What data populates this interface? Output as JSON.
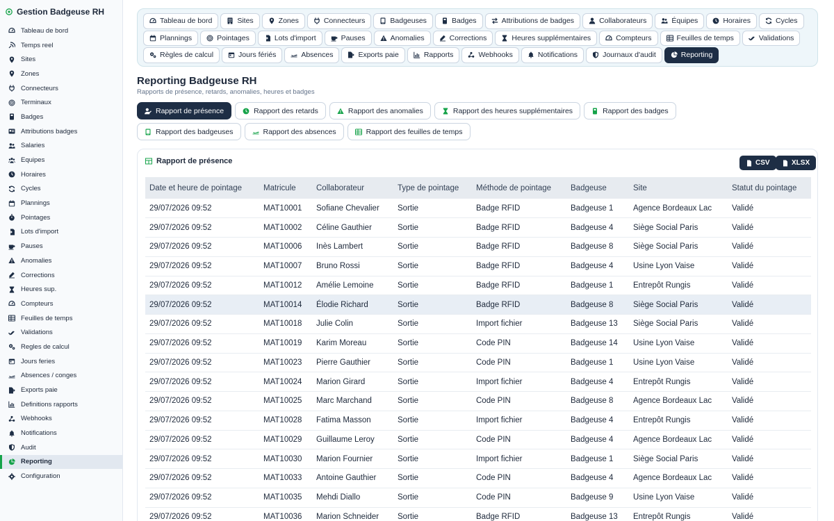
{
  "app": {
    "title": "Gestion Badgeuse RH"
  },
  "sidebar": {
    "items": [
      {
        "label": "Tableau de bord",
        "icon": "gauge-icon"
      },
      {
        "label": "Temps reel",
        "icon": "signal-icon"
      },
      {
        "label": "Sites",
        "icon": "location-pin-icon"
      },
      {
        "label": "Zones",
        "icon": "location-pin-icon"
      },
      {
        "label": "Connecteurs",
        "icon": "plug-icon"
      },
      {
        "label": "Terminaux",
        "icon": "fingerprint-icon"
      },
      {
        "label": "Badges",
        "icon": "badge-icon"
      },
      {
        "label": "Attributions badges",
        "icon": "id-card-icon"
      },
      {
        "label": "Salaries",
        "icon": "users-icon"
      },
      {
        "label": "Equipes",
        "icon": "team-icon"
      },
      {
        "label": "Horaires",
        "icon": "clock-icon"
      },
      {
        "label": "Cycles",
        "icon": "refresh-icon"
      },
      {
        "label": "Plannings",
        "icon": "calendar-icon"
      },
      {
        "label": "Pointages",
        "icon": "stopwatch-icon"
      },
      {
        "label": "Lots d'import",
        "icon": "file-import-icon"
      },
      {
        "label": "Pauses",
        "icon": "coffee-icon"
      },
      {
        "label": "Anomalies",
        "icon": "warning-icon"
      },
      {
        "label": "Corrections",
        "icon": "edit-icon"
      },
      {
        "label": "Heures sup.",
        "icon": "hourglass-icon"
      },
      {
        "label": "Compteurs",
        "icon": "gauge-icon"
      },
      {
        "label": "Feuilles de temps",
        "icon": "timesheet-icon"
      },
      {
        "label": "Validations",
        "icon": "check-double-icon"
      },
      {
        "label": "Regles de calcul",
        "icon": "cogs-icon"
      },
      {
        "label": "Jours feries",
        "icon": "calendar-day-icon"
      },
      {
        "label": "Absences / conges",
        "icon": "plane-icon"
      },
      {
        "label": "Exports paie",
        "icon": "file-export-icon"
      },
      {
        "label": "Definitions rapports",
        "icon": "chart-icon"
      },
      {
        "label": "Webhooks",
        "icon": "webhook-icon"
      },
      {
        "label": "Notifications",
        "icon": "bell-icon"
      },
      {
        "label": "Audit",
        "icon": "shield-icon"
      },
      {
        "label": "Reporting",
        "icon": "pie-chart-icon",
        "active": true
      },
      {
        "label": "Configuration",
        "icon": "gear-icon"
      }
    ]
  },
  "tabs": [
    {
      "label": "Tableau de bord",
      "icon": "gauge-icon"
    },
    {
      "label": "Sites",
      "icon": "building-icon"
    },
    {
      "label": "Zones",
      "icon": "location-pin-icon"
    },
    {
      "label": "Connecteurs",
      "icon": "plug-icon"
    },
    {
      "label": "Badgeuses",
      "icon": "tablet-icon"
    },
    {
      "label": "Badges",
      "icon": "badge-icon"
    },
    {
      "label": "Attributions de badges",
      "icon": "exchange-icon"
    },
    {
      "label": "Collaborateurs",
      "icon": "user-icon"
    },
    {
      "label": "Équipes",
      "icon": "users-icon"
    },
    {
      "label": "Horaires",
      "icon": "clock-icon"
    },
    {
      "label": "Cycles",
      "icon": "refresh-icon"
    },
    {
      "label": "Plannings",
      "icon": "calendar-icon"
    },
    {
      "label": "Pointages",
      "icon": "fingerprint-icon"
    },
    {
      "label": "Lots d'import",
      "icon": "file-import-icon"
    },
    {
      "label": "Pauses",
      "icon": "coffee-icon"
    },
    {
      "label": "Anomalies",
      "icon": "warning-icon"
    },
    {
      "label": "Corrections",
      "icon": "edit-icon"
    },
    {
      "label": "Heures supplémentaires",
      "icon": "hourglass-icon"
    },
    {
      "label": "Compteurs",
      "icon": "gauge-icon"
    },
    {
      "label": "Feuilles de temps",
      "icon": "timesheet-icon"
    },
    {
      "label": "Validations",
      "icon": "check-double-icon"
    },
    {
      "label": "Règles de calcul",
      "icon": "cogs-icon"
    },
    {
      "label": "Jours fériés",
      "icon": "calendar-day-icon"
    },
    {
      "label": "Absences",
      "icon": "plane-icon"
    },
    {
      "label": "Exports paie",
      "icon": "file-export-icon"
    },
    {
      "label": "Rapports",
      "icon": "chart-icon"
    },
    {
      "label": "Webhooks",
      "icon": "webhook-icon"
    },
    {
      "label": "Notifications",
      "icon": "bell-icon"
    },
    {
      "label": "Journaux d'audit",
      "icon": "shield-icon"
    },
    {
      "label": "Reporting",
      "icon": "pie-chart-icon",
      "active": true
    }
  ],
  "page": {
    "title": "Reporting Badgeuse RH",
    "subtitle": "Rapports de présence, retards, anomalies, heures et badges"
  },
  "reports": [
    {
      "label": "Rapport de présence",
      "icon": "user-check-icon",
      "active": true
    },
    {
      "label": "Rapport des retards",
      "icon": "clock-icon"
    },
    {
      "label": "Rapport des anomalies",
      "icon": "warning-icon"
    },
    {
      "label": "Rapport des heures supplémentaires",
      "icon": "hourglass-icon"
    },
    {
      "label": "Rapport des badges",
      "icon": "badge-icon"
    },
    {
      "label": "Rapport des badgeuses",
      "icon": "tablet-icon"
    },
    {
      "label": "Rapport des absences",
      "icon": "plane-icon"
    },
    {
      "label": "Rapport des feuilles de temps",
      "icon": "timesheet-icon"
    }
  ],
  "card": {
    "title": "Rapport de présence",
    "csv_label": "CSV",
    "xlsx_label": "XLSX"
  },
  "table": {
    "columns": [
      "Date et heure de pointage",
      "Matricule",
      "Collaborateur",
      "Type de pointage",
      "Méthode de pointage",
      "Badgeuse",
      "Site",
      "Statut du pointage"
    ],
    "rows": [
      [
        "29/07/2026 09:52",
        "MAT10001",
        "Sofiane Chevalier",
        "Sortie",
        "Badge RFID",
        "Badgeuse 1",
        "Agence Bordeaux Lac",
        "Validé"
      ],
      [
        "29/07/2026 09:52",
        "MAT10002",
        "Céline Gauthier",
        "Sortie",
        "Badge RFID",
        "Badgeuse 4",
        "Siège Social Paris",
        "Validé"
      ],
      [
        "29/07/2026 09:52",
        "MAT10006",
        "Inès Lambert",
        "Sortie",
        "Badge RFID",
        "Badgeuse 8",
        "Siège Social Paris",
        "Validé"
      ],
      [
        "29/07/2026 09:52",
        "MAT10007",
        "Bruno Rossi",
        "Sortie",
        "Badge RFID",
        "Badgeuse 4",
        "Usine Lyon Vaise",
        "Validé"
      ],
      [
        "29/07/2026 09:52",
        "MAT10012",
        "Amélie Lemoine",
        "Sortie",
        "Badge RFID",
        "Badgeuse 1",
        "Entrepôt Rungis",
        "Validé"
      ],
      [
        "29/07/2026 09:52",
        "MAT10014",
        "Élodie Richard",
        "Sortie",
        "Badge RFID",
        "Badgeuse 8",
        "Siège Social Paris",
        "Validé"
      ],
      [
        "29/07/2026 09:52",
        "MAT10018",
        "Julie Colin",
        "Sortie",
        "Import fichier",
        "Badgeuse 13",
        "Siège Social Paris",
        "Validé"
      ],
      [
        "29/07/2026 09:52",
        "MAT10019",
        "Karim Moreau",
        "Sortie",
        "Code PIN",
        "Badgeuse 14",
        "Usine Lyon Vaise",
        "Validé"
      ],
      [
        "29/07/2026 09:52",
        "MAT10023",
        "Pierre Gauthier",
        "Sortie",
        "Code PIN",
        "Badgeuse 1",
        "Usine Lyon Vaise",
        "Validé"
      ],
      [
        "29/07/2026 09:52",
        "MAT10024",
        "Marion Girard",
        "Sortie",
        "Import fichier",
        "Badgeuse 4",
        "Entrepôt Rungis",
        "Validé"
      ],
      [
        "29/07/2026 09:52",
        "MAT10025",
        "Marc Marchand",
        "Sortie",
        "Code PIN",
        "Badgeuse 8",
        "Agence Bordeaux Lac",
        "Validé"
      ],
      [
        "29/07/2026 09:52",
        "MAT10028",
        "Fatima Masson",
        "Sortie",
        "Import fichier",
        "Badgeuse 4",
        "Entrepôt Rungis",
        "Validé"
      ],
      [
        "29/07/2026 09:52",
        "MAT10029",
        "Guillaume Leroy",
        "Sortie",
        "Code PIN",
        "Badgeuse 4",
        "Agence Bordeaux Lac",
        "Validé"
      ],
      [
        "29/07/2026 09:52",
        "MAT10030",
        "Marion Fournier",
        "Sortie",
        "Import fichier",
        "Badgeuse 1",
        "Siège Social Paris",
        "Validé"
      ],
      [
        "29/07/2026 09:52",
        "MAT10033",
        "Antoine Gauthier",
        "Sortie",
        "Code PIN",
        "Badgeuse 4",
        "Agence Bordeaux Lac",
        "Validé"
      ],
      [
        "29/07/2026 09:52",
        "MAT10035",
        "Mehdi Diallo",
        "Sortie",
        "Code PIN",
        "Badgeuse 9",
        "Usine Lyon Vaise",
        "Validé"
      ],
      [
        "29/07/2026 09:52",
        "MAT10036",
        "Marion Schneider",
        "Sortie",
        "Badge RFID",
        "Badgeuse 13",
        "Entrepôt Rungis",
        "Validé"
      ]
    ],
    "highlighted_row": 5
  }
}
